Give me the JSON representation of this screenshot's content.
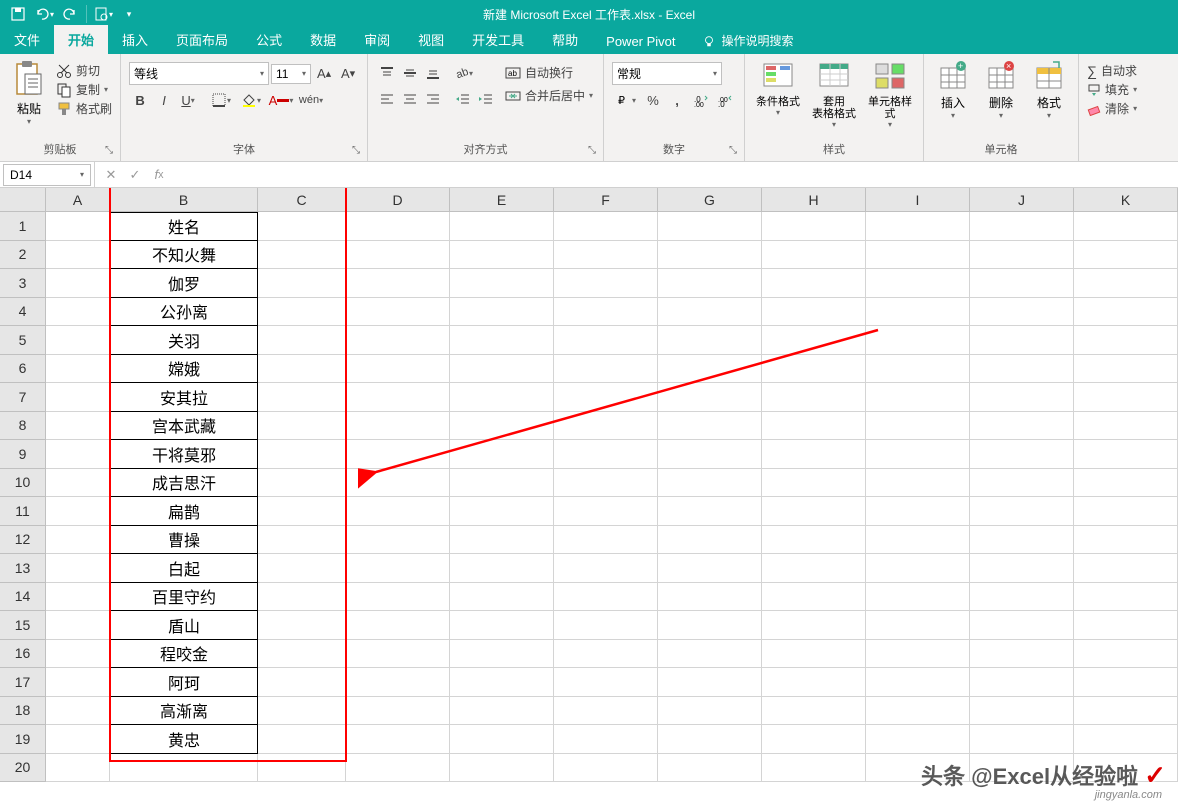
{
  "title": "新建 Microsoft Excel 工作表.xlsx  -  Excel",
  "tabs": [
    "文件",
    "开始",
    "插入",
    "页面布局",
    "公式",
    "数据",
    "审阅",
    "视图",
    "开发工具",
    "帮助",
    "Power Pivot"
  ],
  "tellme": "操作说明搜索",
  "clipboard": {
    "paste": "粘贴",
    "cut": "剪切",
    "copy": "复制",
    "painter": "格式刷",
    "label": "剪贴板"
  },
  "font": {
    "name": "等线",
    "size": "11",
    "label": "字体"
  },
  "align": {
    "wrap": "自动换行",
    "merge": "合并后居中",
    "label": "对齐方式"
  },
  "number": {
    "format": "常规",
    "label": "数字"
  },
  "styles": {
    "cond": "条件格式",
    "table": "套用\n表格格式",
    "cell": "单元格样式",
    "label": "样式"
  },
  "cells": {
    "insert": "插入",
    "delete": "删除",
    "format": "格式",
    "label": "单元格"
  },
  "editing": {
    "sum": "自动求",
    "fill": "填充",
    "clear": "清除"
  },
  "namebox": "D14",
  "columns": [
    "A",
    "B",
    "C",
    "D",
    "E",
    "F",
    "G",
    "H",
    "I",
    "J",
    "K"
  ],
  "rows": [
    "1",
    "2",
    "3",
    "4",
    "5",
    "6",
    "7",
    "8",
    "9",
    "10",
    "11",
    "12",
    "13",
    "14",
    "15",
    "16",
    "17",
    "18",
    "19",
    "20"
  ],
  "data_b": [
    "姓名",
    "不知火舞",
    "伽罗",
    "公孙离",
    "关羽",
    "嫦娥",
    "安其拉",
    "宫本武藏",
    "干将莫邪",
    "成吉思汗",
    "扁鹊",
    "曹操",
    "白起",
    "百里守约",
    "盾山",
    "程咬金",
    "阿珂",
    "高渐离",
    "黄忠"
  ],
  "watermark": "头条 @Excel从经验啦",
  "watermark2": "jingyanla.com"
}
